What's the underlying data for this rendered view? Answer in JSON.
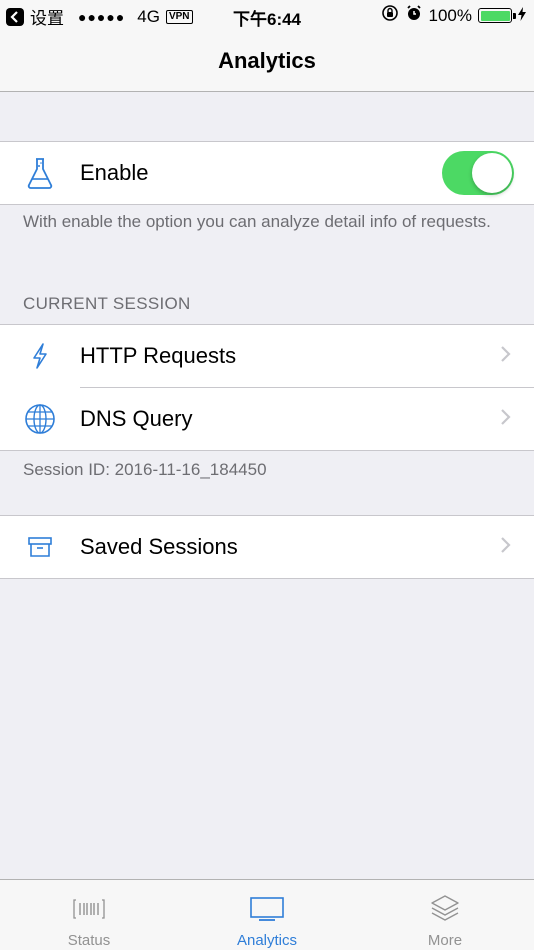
{
  "status_bar": {
    "back_app": "设置",
    "signal": "●●●●●",
    "network": "4G",
    "vpn": "VPN",
    "time": "下午6:44",
    "battery": "100%",
    "battery_level": 1.0
  },
  "nav": {
    "title": "Analytics"
  },
  "enable": {
    "label": "Enable",
    "toggle_on": true,
    "description": "With enable the option you can analyze detail info of requests."
  },
  "current_session": {
    "header": "CURRENT SESSION",
    "items": [
      {
        "label": "HTTP Requests",
        "icon": "bolt-icon"
      },
      {
        "label": "DNS Query",
        "icon": "globe-icon"
      }
    ],
    "session_id": "Session ID: 2016-11-16_184450"
  },
  "saved": {
    "label": "Saved Sessions",
    "icon": "archive-box-icon"
  },
  "tabs": [
    {
      "label": "Status",
      "icon": "barcode-icon",
      "active": false
    },
    {
      "label": "Analytics",
      "icon": "monitor-icon",
      "active": true
    },
    {
      "label": "More",
      "icon": "layers-icon",
      "active": false
    }
  ],
  "colors": {
    "accent": "#2f7ed8",
    "toggle_on": "#4cd964",
    "background": "#efeff4"
  }
}
